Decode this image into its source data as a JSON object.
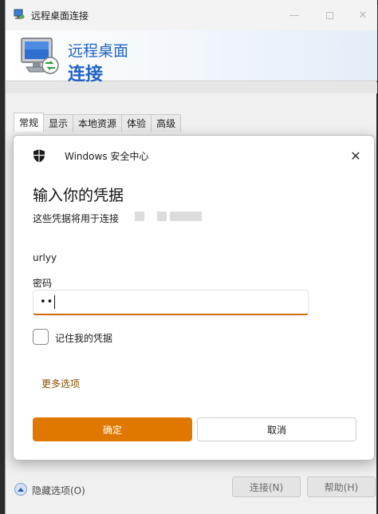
{
  "rdp_window": {
    "title": "远程桌面连接",
    "banner_line1": "远程桌面",
    "banner_line2": "连接",
    "tabs": [
      "常规",
      "显示",
      "本地资源",
      "体验",
      "高级"
    ],
    "hide_options": "隐藏选项(O)",
    "connect_button": "连接(N)",
    "help_button": "帮助(H)"
  },
  "dialog": {
    "source": "Windows 安全中心",
    "title": "输入你的凭据",
    "description": "这些凭据将用于连接",
    "username": "urlyy",
    "password_label": "密码",
    "password_masked": "••",
    "remember_label": "记住我的凭据",
    "remember_checked": false,
    "more_options": "更多选项",
    "ok_button": "确定",
    "cancel_button": "取消"
  },
  "colors": {
    "accent": "#e07800",
    "link": "#8a4f00",
    "banner_text": "#1f62c4"
  }
}
